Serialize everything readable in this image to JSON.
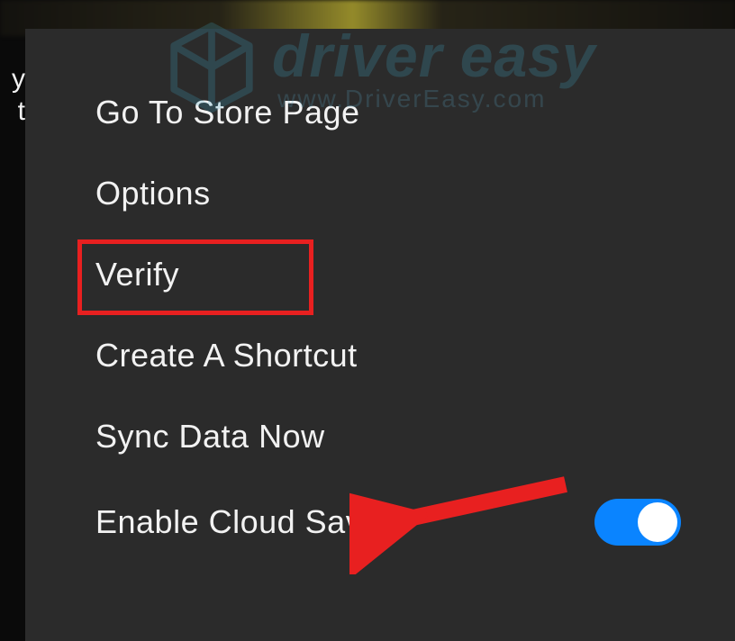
{
  "left_sliver": {
    "line1": "y",
    "line2": "t"
  },
  "menu": {
    "items": [
      {
        "label": "Go To Store Page"
      },
      {
        "label": "Options"
      },
      {
        "label": "Verify"
      },
      {
        "label": "Create A Shortcut"
      },
      {
        "label": "Sync Data Now"
      },
      {
        "label": "Enable Cloud Save"
      }
    ]
  },
  "toggle": {
    "on": true
  },
  "watermark": {
    "brand": "driver easy",
    "url": "www.DriverEasy.com"
  },
  "annotation": {
    "highlight": "Verify",
    "arrow_color": "#e82020"
  }
}
